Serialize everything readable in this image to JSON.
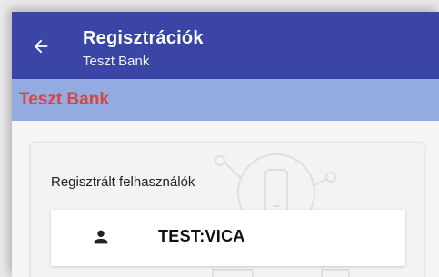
{
  "appbar": {
    "back_icon": "arrow-left-icon",
    "title": "Regisztrációk",
    "subtitle": "Teszt Bank",
    "background_color": "#3a45a5"
  },
  "bank_header": {
    "name": "Teszt Bank",
    "background_color": "#93abe1",
    "text_color": "#d9453d"
  },
  "registered_users": {
    "section_label": "Regisztrált felhasználók",
    "items": [
      {
        "icon": "person-icon",
        "name": "TEST:VICA"
      }
    ]
  }
}
